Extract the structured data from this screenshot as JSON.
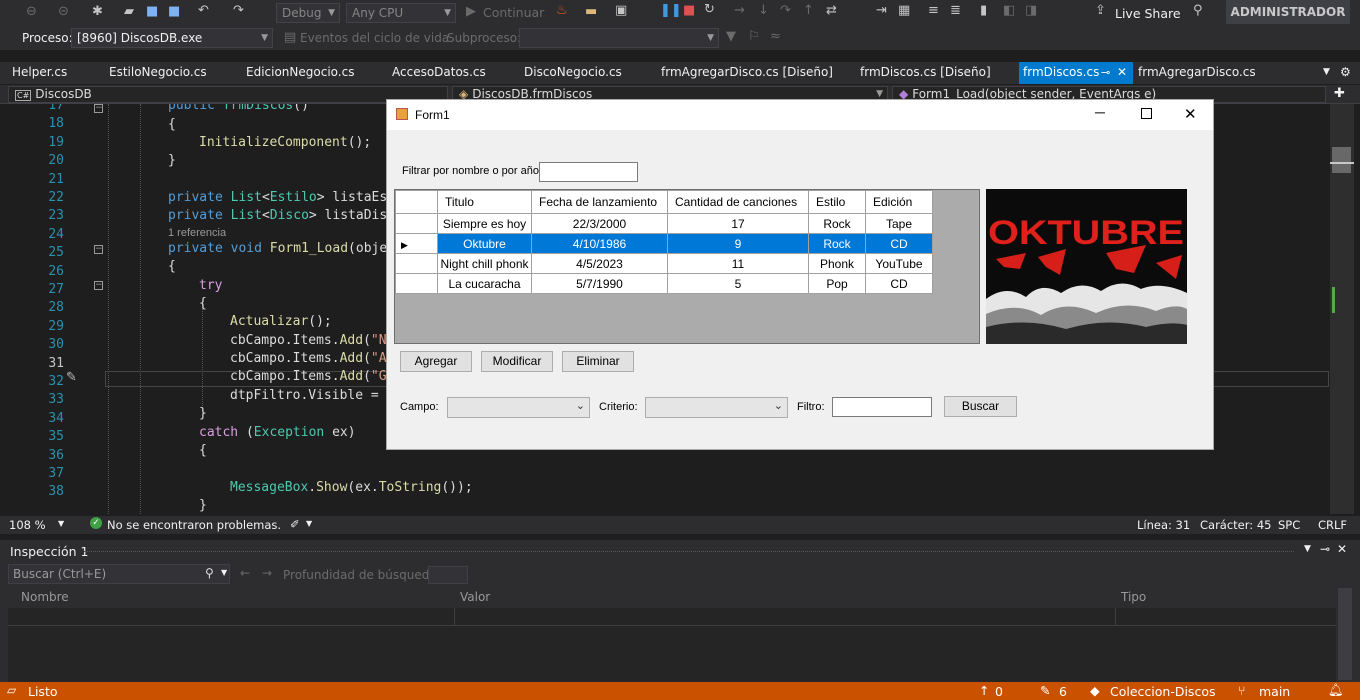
{
  "toolbar": {
    "config": "Debug",
    "platform": "Any CPU",
    "continue_label": "Continuar",
    "live_share": "Live Share",
    "user": "ADMINISTRADOR",
    "process_label": "Proceso:",
    "process_value": "[8960] DiscosDB.exe",
    "lifecycle_events": "Eventos del ciclo de vida",
    "subprocess_label": "Subproceso:"
  },
  "tabs": [
    {
      "label": "Helper.cs"
    },
    {
      "label": "EstiloNegocio.cs"
    },
    {
      "label": "EdicionNegocio.cs"
    },
    {
      "label": "AccesoDatos.cs"
    },
    {
      "label": "DiscoNegocio.cs"
    },
    {
      "label": "frmAgregarDisco.cs [Diseño]"
    },
    {
      "label": "frmDiscos.cs [Diseño]"
    },
    {
      "label": "frmDiscos.cs"
    },
    {
      "label": "frmAgregarDisco.cs"
    }
  ],
  "navbar": {
    "project_badge": "C#",
    "project": "DiscosDB",
    "class": "DiscosDB.frmDiscos",
    "member": "Form1_Load(object sender, EventArgs e)"
  },
  "editor": {
    "line_numbers": [
      "17",
      "18",
      "19",
      "20",
      "21",
      "22",
      "23",
      "24",
      "25",
      "26",
      "27",
      "28",
      "29",
      "30",
      "31",
      "32",
      "33",
      "34",
      "35",
      "36",
      "37",
      "38"
    ],
    "reference_hint": "1 referencia"
  },
  "status_line": {
    "zoom": "108 %",
    "issues": "No se encontraron problemas.",
    "line": "Línea: 31",
    "char": "Carácter: 45",
    "spc": "SPC",
    "crlf": "CRLF"
  },
  "inspect_panel": {
    "title": "Inspección 1",
    "search_placeholder": "Buscar (Ctrl+E)",
    "depth_label": "Profundidad de búsqueda:",
    "columns": [
      "Nombre",
      "Valor",
      "Tipo"
    ]
  },
  "statusbar": {
    "ready": "Listo",
    "up_count": "0",
    "edit_count": "6",
    "repo": "Coleccion-Discos",
    "branch": "main"
  },
  "form": {
    "title": "Form1",
    "filter_label": "Filtrar por nombre o por año:",
    "filter_value": "",
    "grid_headers": [
      "Titulo",
      "Fecha de lanzamiento",
      "Cantidad de canciones",
      "Estilo",
      "Edición"
    ],
    "grid_rows": [
      [
        "Siempre es hoy",
        "22/3/2000",
        "17",
        "Rock",
        "Tape"
      ],
      [
        "Oktubre",
        "4/10/1986",
        "9",
        "Rock",
        "CD"
      ],
      [
        "Night chill phonk",
        "4/5/2023",
        "11",
        "Phonk",
        "YouTube"
      ],
      [
        "La cucaracha",
        "5/7/1990",
        "5",
        "Pop",
        "CD"
      ]
    ],
    "selected_row": 1,
    "poster_text": "OKTUBRE",
    "btn_add": "Agregar",
    "btn_modify": "Modificar",
    "btn_delete": "Eliminar",
    "campo_label": "Campo:",
    "criterio_label": "Criterio:",
    "filtro_label": "Filtro:",
    "btn_search": "Buscar"
  },
  "colors": {
    "accent": "#007acc",
    "statusbar": "#ca5100",
    "selection": "#0078d7"
  }
}
